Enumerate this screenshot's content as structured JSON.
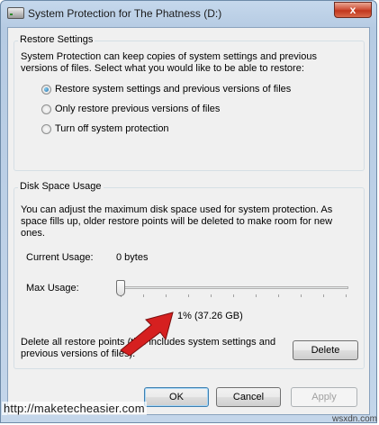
{
  "window": {
    "title": "System Protection for The Phatness (D:)",
    "close_label": "x"
  },
  "restore_settings": {
    "legend": "Restore Settings",
    "description": "System Protection can keep copies of system settings and previous versions of files. Select what you would like to be able to restore:",
    "options": [
      {
        "label": "Restore system settings and previous versions of files",
        "checked": true
      },
      {
        "label": "Only restore previous versions of files",
        "checked": false
      },
      {
        "label": "Turn off system protection",
        "checked": false
      }
    ]
  },
  "disk_space": {
    "legend": "Disk Space Usage",
    "description": "You can adjust the maximum disk space used for system protection. As space fills up, older restore points will be deleted to make room for new ones.",
    "current_usage_label": "Current Usage:",
    "current_usage_value": "0 bytes",
    "max_usage_label": "Max Usage:",
    "max_usage_value": "1% (37.26 GB)",
    "max_usage_percent": 1,
    "delete_text": "Delete all restore points (this includes system settings and previous versions of files).",
    "delete_button": "Delete"
  },
  "footer": {
    "ok": "OK",
    "cancel": "Cancel",
    "apply": "Apply"
  },
  "watermark": "http://maketecheasier.com",
  "corner_mark": "wsxdn.com",
  "colors": {
    "arrow": "#d62020",
    "close_button": "#c1371d"
  }
}
